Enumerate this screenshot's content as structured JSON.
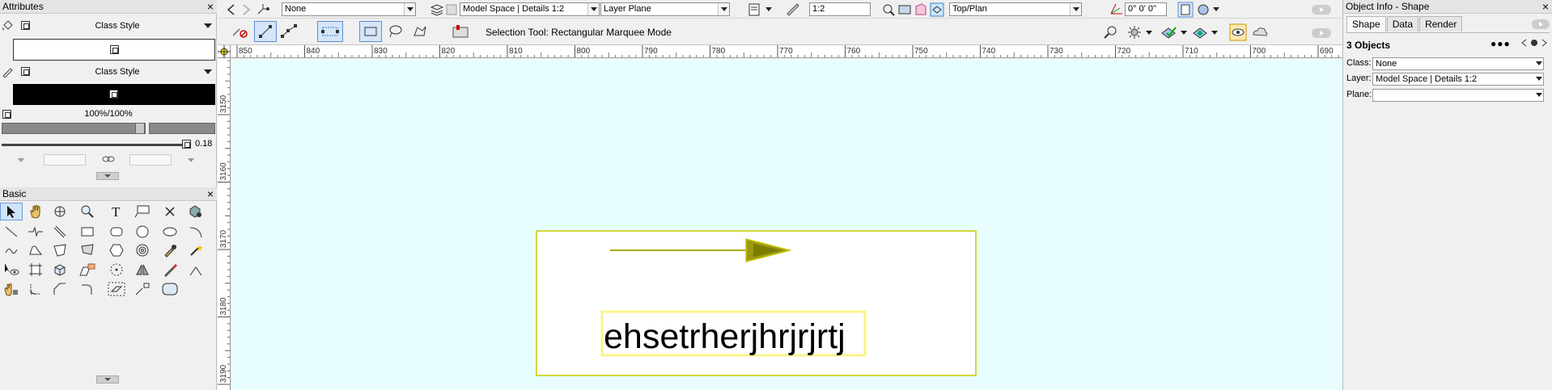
{
  "attributes_panel": {
    "title": "Attributes",
    "fill": {
      "style_label": "Class Style"
    },
    "pen": {
      "style_label": "Class Style"
    },
    "opacity": "100%/100%",
    "line_thickness": "0.18"
  },
  "basic_palette": {
    "title": "Basic"
  },
  "toolbar": {
    "class_combo": "None",
    "layer_combo": "Model Space | Details 1:2",
    "plane_combo": "Layer Plane",
    "scale_value": "1:2",
    "view_combo": "Top/Plan",
    "rotation_value": "0° 0' 0\""
  },
  "mode_bar": {
    "status_text": "Selection Tool: Rectangular Marquee Mode"
  },
  "ruler": {
    "h_ticks": [
      "850",
      "840",
      "830",
      "820",
      "810",
      "800",
      "790",
      "780",
      "770",
      "760",
      "750",
      "740",
      "730",
      "720",
      "710",
      "700",
      "690"
    ],
    "v_ticks": [
      "3150",
      "3160",
      "3170",
      "3180",
      "3190"
    ]
  },
  "drawing": {
    "text_object": "ehsetrherjhrjrjrtj"
  },
  "object_info": {
    "title": "Object Info - Shape",
    "tabs": [
      "Shape",
      "Data",
      "Render"
    ],
    "header": "3 Objects",
    "class_label": "Class:",
    "class_value": "None",
    "layer_label": "Layer:",
    "layer_value": "Model Space | Details 1:2",
    "plane_label": "Plane:",
    "plane_value": ""
  },
  "colors": {
    "canvas": "#e8fefe",
    "selection": "#c8c800",
    "arrow": "#8c8c00"
  }
}
